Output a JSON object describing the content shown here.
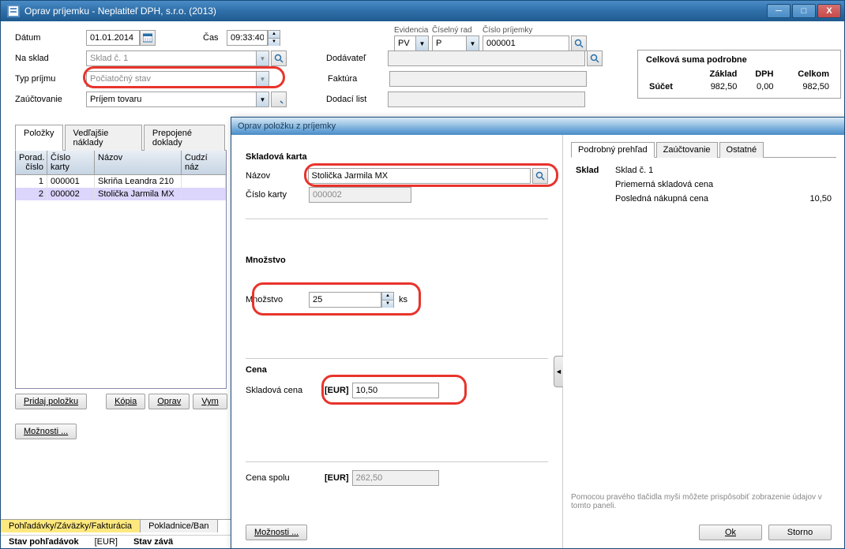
{
  "window": {
    "title": "Oprav príjemku - Neplatiteľ DPH, s.r.o. (2013)"
  },
  "form": {
    "datum_label": "Dátum",
    "datum_value": "01.01.2014",
    "cas_label": "Čas",
    "cas_value": "09:33:40",
    "nasklad_label": "Na sklad",
    "nasklad_value": "Sklad č. 1",
    "typprijmu_label": "Typ príjmu",
    "typprijmu_value": "Počiatočný stav",
    "zauctovanie_label": "Zaúčtovanie",
    "zauctovanie_value": "Príjem tovaru",
    "dodavatel_label": "Dodávateľ",
    "faktura_label": "Faktúra",
    "dodacilist_label": "Dodací list"
  },
  "evidencia": {
    "evidencia_label": "Evidencia",
    "evidencia_value": "PV",
    "ciselnyrad_label": "Číselný rad",
    "ciselnyrad_value": "P",
    "cisloprijemky_label": "Číslo príjemky",
    "cisloprijemky_value": "000001"
  },
  "summary": {
    "title": "Celková suma podrobne",
    "col_zaklad": "Základ",
    "col_dph": "DPH",
    "col_celkom": "Celkom",
    "sucet_label": "Súčet",
    "sucet_zaklad": "982,50",
    "sucet_dph": "0,00",
    "sucet_celkom": "982,50"
  },
  "main_tabs": {
    "polozky": "Položky",
    "vedlajsie": "Vedľajšie náklady",
    "prepojene": "Prepojené doklady"
  },
  "grid": {
    "col_porad": "Porad. číslo",
    "col_cislokarty": "Číslo karty",
    "col_nazov": "Názov",
    "col_cudzi": "Cudzí náz",
    "rows": [
      {
        "porad": "1",
        "cislo": "000001",
        "nazov": "Skriňa Leandra 210"
      },
      {
        "porad": "2",
        "cislo": "000002",
        "nazov": "Stolička Jarmila MX"
      }
    ]
  },
  "buttons": {
    "pridaj": "Pridaj položku",
    "kopia": "Kópia",
    "oprav": "Oprav",
    "vymaz": "Vym",
    "moznosti": "Možnosti ..."
  },
  "sub": {
    "title": "Oprav položku z príjemky",
    "skladkarta_title": "Skladová karta",
    "nazov_label": "Názov",
    "nazov_value": "Stolička Jarmila MX",
    "cislokarty_label": "Číslo karty",
    "cislokarty_value": "000002",
    "mnozstvo_title": "Množstvo",
    "mnozstvo_label": "Množstvo",
    "mnozstvo_value": "25",
    "unit": "ks",
    "cena_title": "Cena",
    "skladcena_label": "Skladová cena",
    "currency": "[EUR]",
    "skladcena_value": "10,50",
    "cenaspolu_label": "Cena spolu",
    "cenaspolu_value": "262,50",
    "moznosti": "Možnosti ...",
    "ok": "Ok",
    "storno": "Storno"
  },
  "sub_tabs": {
    "prehlad": "Podrobný prehľad",
    "zauctovanie": "Zaúčtovanie",
    "ostatne": "Ostatné"
  },
  "sub_detail": {
    "sklad_label": "Sklad",
    "sklad_value": "Sklad č. 1",
    "priemerna": "Priemerná skladová cena",
    "posledna": "Posledná nákupná cena",
    "posledna_value": "10,50",
    "hint": "Pomocou pravého tlačidla myši môžete prispôsobiť zobrazenie údajov v tomto paneli."
  },
  "bottom": {
    "pohladavky_tab": "Pohľadávky/Záväzky/Fakturácia",
    "pokladnice_tab": "Pokladnice/Ban",
    "stav_pohladavok": "Stav pohľadávok",
    "eur": "[EUR]",
    "stav_zava": "Stav závä"
  }
}
